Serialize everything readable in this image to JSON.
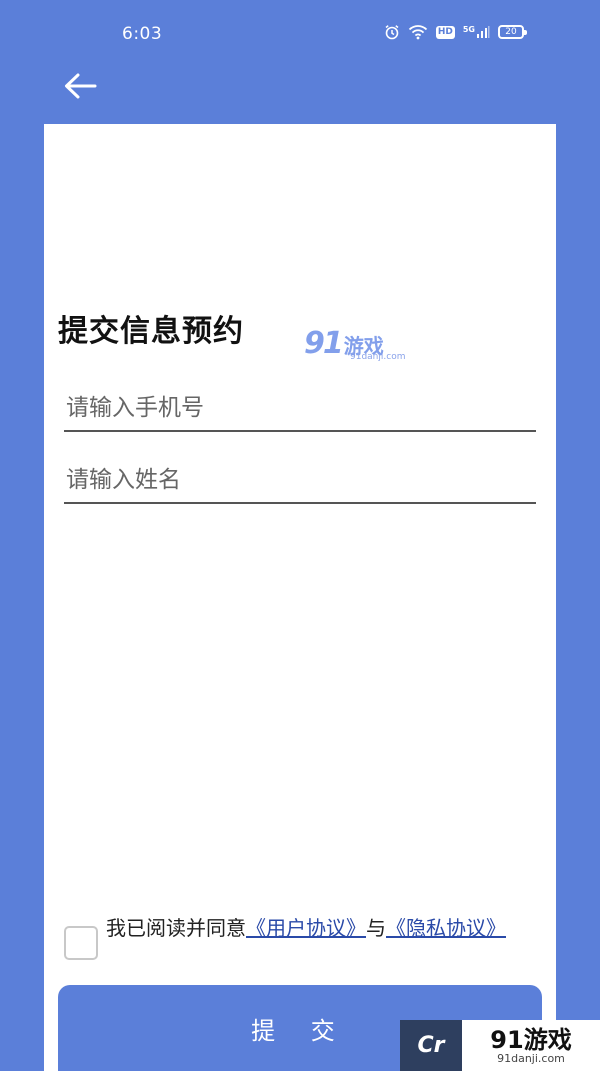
{
  "status_bar": {
    "time": "6:03",
    "icons": [
      "alarm-icon",
      "wifi-icon",
      "hd-icon",
      "signal-5g-icon",
      "battery-icon"
    ],
    "hd_label": "HD",
    "network_label": "5G",
    "battery_level": "20"
  },
  "header": {
    "back_icon": "arrow-left-icon"
  },
  "form": {
    "title": "提交信息预约",
    "phone_placeholder": "请输入手机号",
    "name_placeholder": "请输入姓名"
  },
  "agreement": {
    "prefix": "我已阅读并同意",
    "user_agreement_link": "《用户协议》",
    "connector": "与",
    "privacy_link": "《隐私协议》"
  },
  "submit": {
    "label": "提 交"
  },
  "watermark": {
    "logo": "91",
    "name": "游戏",
    "domain": "91danji.com",
    "corner_mark": "Cr"
  },
  "colors": {
    "primary": "#5b7fd9",
    "card": "#ffffff",
    "link": "#2a4aa8",
    "text": "#111111"
  }
}
